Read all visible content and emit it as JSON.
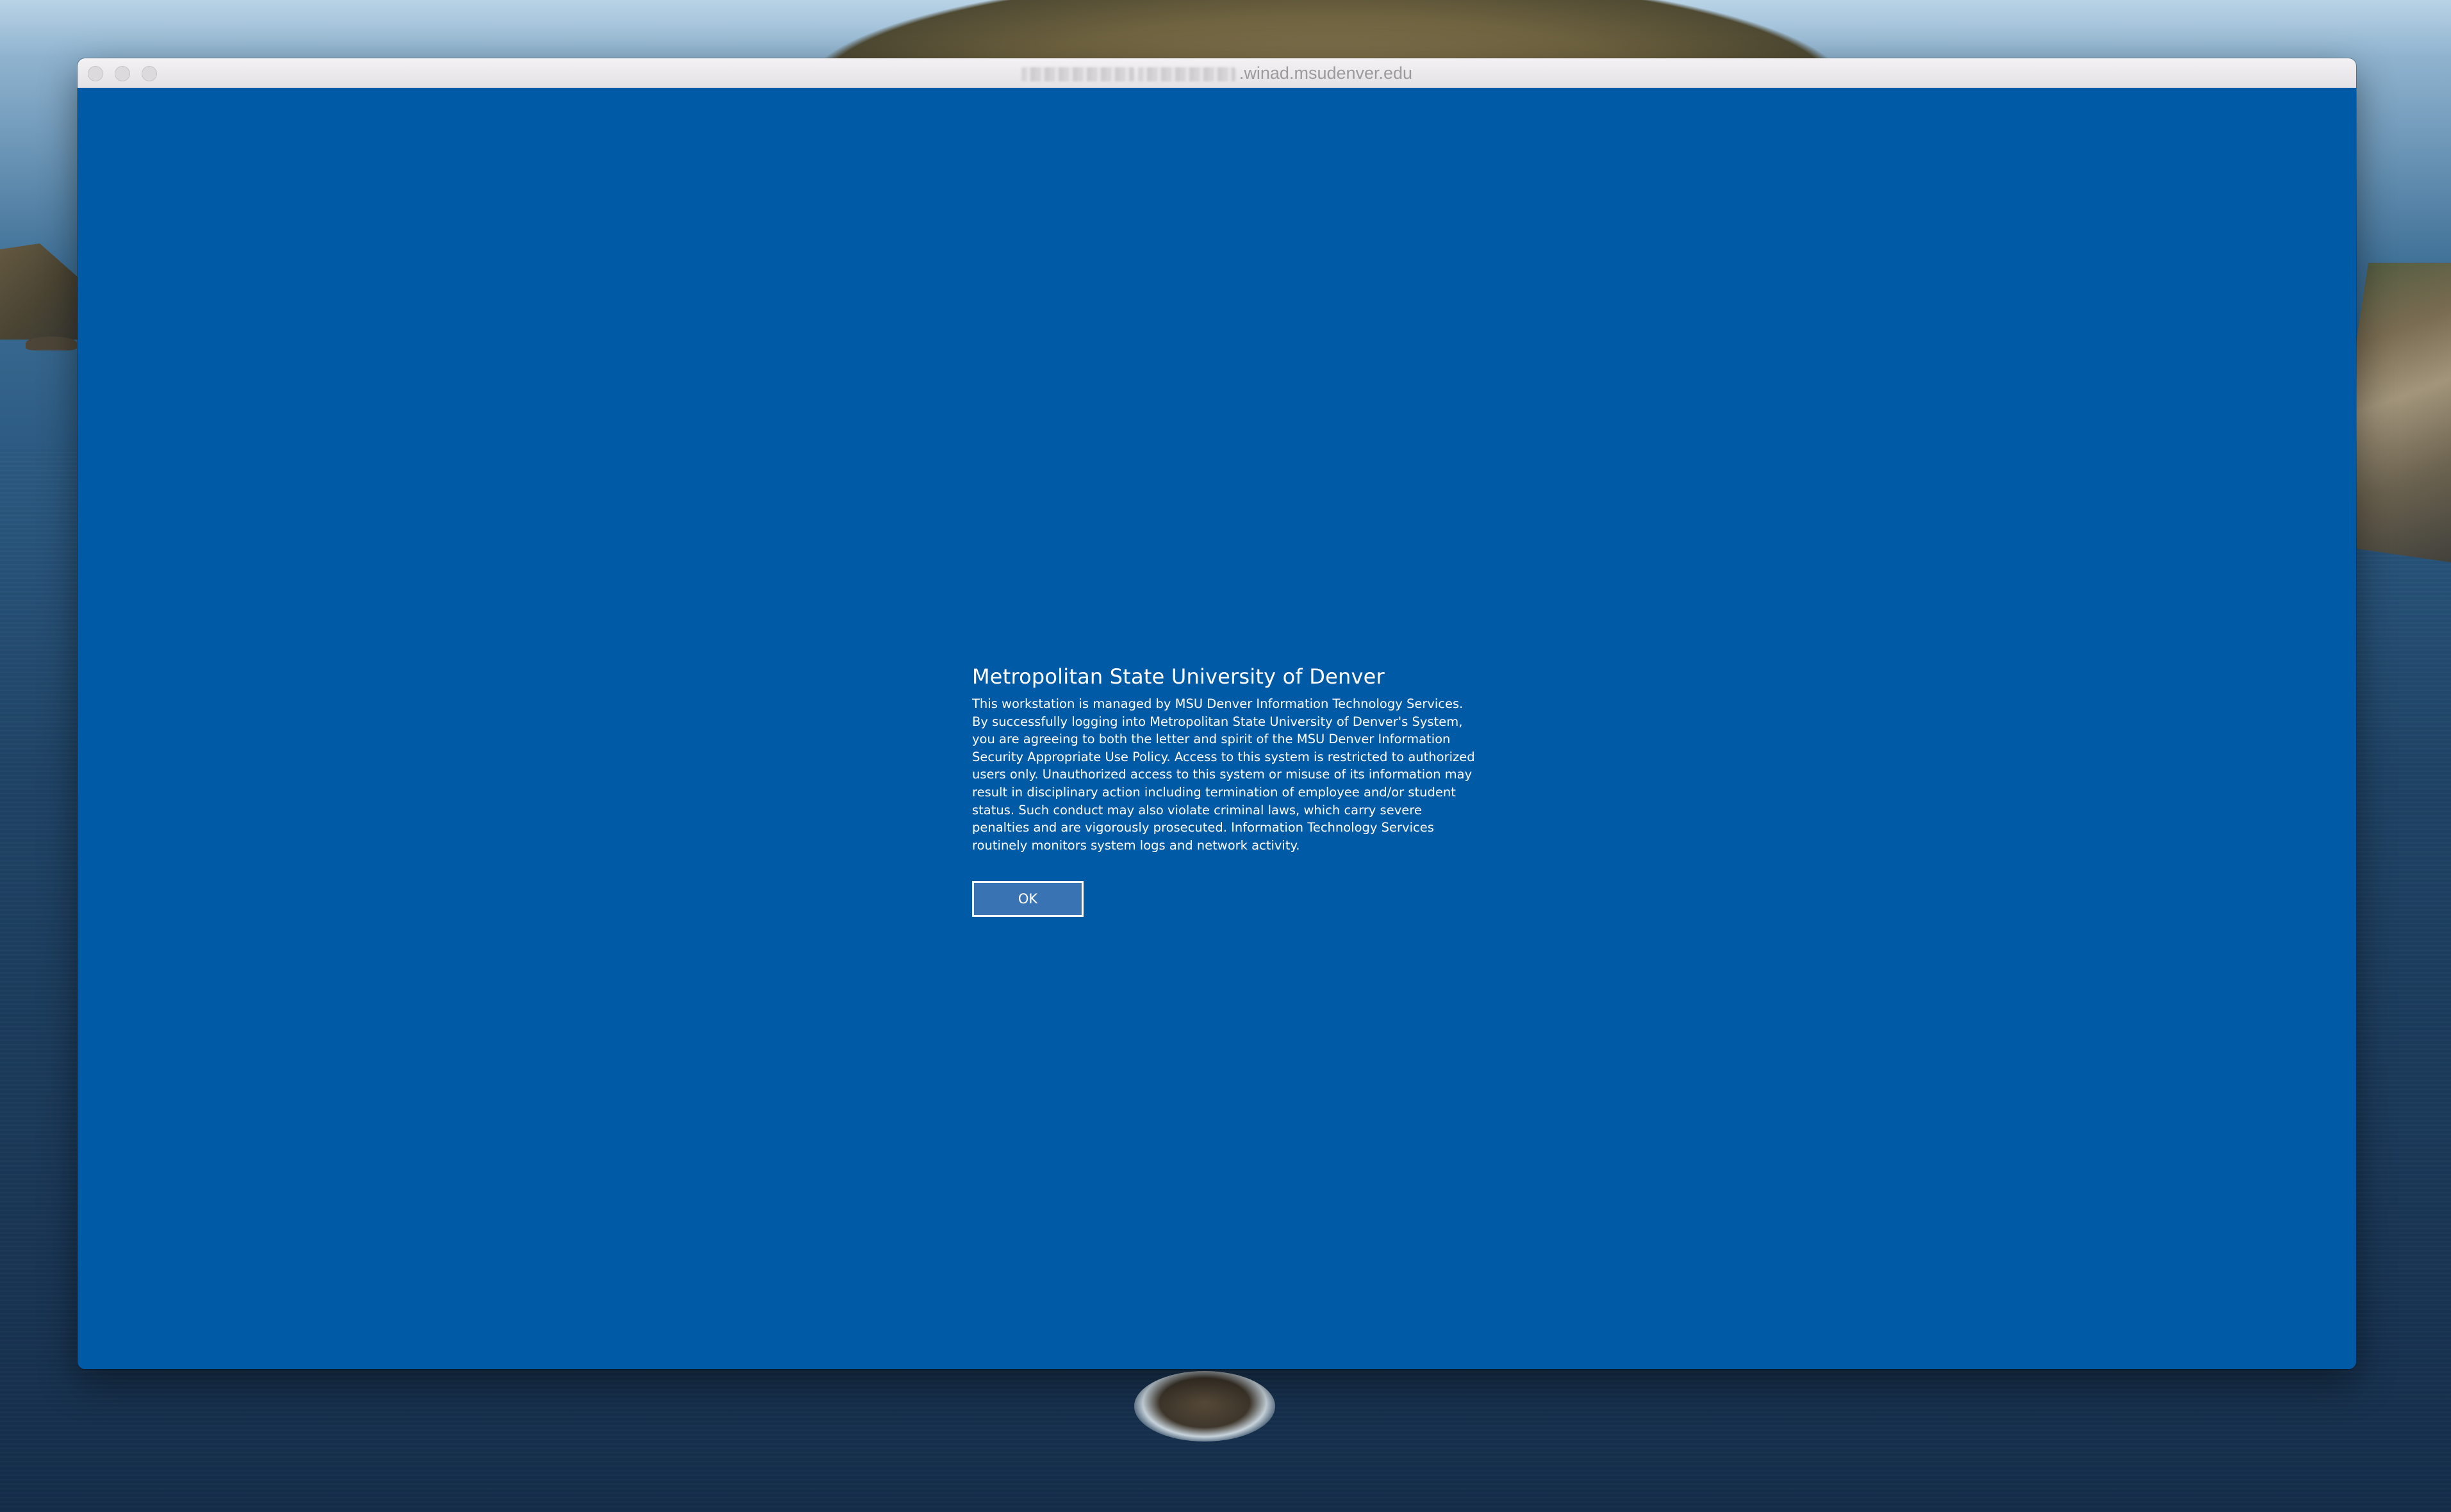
{
  "window": {
    "title_suffix": ".winad.msudenver.edu",
    "background_color": "#005aa6"
  },
  "notice": {
    "title": "Metropolitan State University of Denver",
    "body": "This workstation is managed by MSU Denver Information Technology Services. By successfully logging into Metropolitan State University of Denver's System, you are agreeing to both the letter and spirit of the MSU Denver Information Security Appropriate Use Policy. Access to this system is restricted to authorized users only. Unauthorized access to this system or misuse of its information may result in disciplinary action including termination of employee and/or student status. Such conduct may also violate criminal laws, which carry severe penalties and are vigorously prosecuted. Information Technology Services routinely monitors system logs and network activity.",
    "ok_label": "OK"
  }
}
